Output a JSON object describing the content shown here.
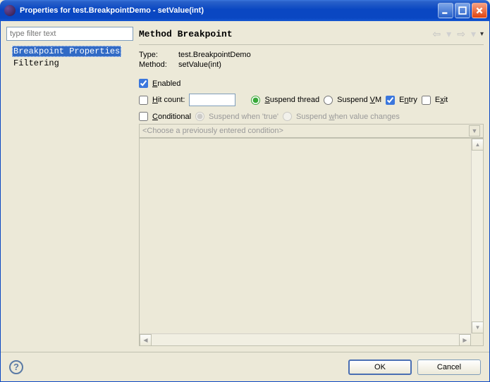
{
  "window": {
    "title": "Properties for test.BreakpointDemo - setValue(int)"
  },
  "filter": {
    "placeholder": "type filter text"
  },
  "tree": {
    "items": [
      {
        "label": "Breakpoint Properties",
        "selected": true
      },
      {
        "label": "Filtering",
        "selected": false
      }
    ]
  },
  "page": {
    "title": "Method Breakpoint",
    "type_label": "Type:",
    "type_value": "test.BreakpointDemo",
    "method_label": "Method:",
    "method_value": "setValue(int)",
    "enabled_label": "Enabled",
    "hit_count_label": "Hit count:",
    "hit_count_value": "",
    "suspend_thread_label": "Suspend thread",
    "suspend_vm_label": "Suspend VM",
    "entry_label": "Entry",
    "exit_label": "Exit",
    "conditional_label": "Conditional",
    "suspend_true_label": "Suspend when 'true'",
    "suspend_changes_label": "Suspend when value changes",
    "condition_combo_placeholder": "<Choose a previously entered condition>"
  },
  "buttons": {
    "ok": "OK",
    "cancel": "Cancel"
  },
  "state": {
    "enabled": true,
    "hit_count": false,
    "suspend_mode": "thread",
    "entry": true,
    "exit": false,
    "conditional": false,
    "suspend_cond": "true"
  }
}
